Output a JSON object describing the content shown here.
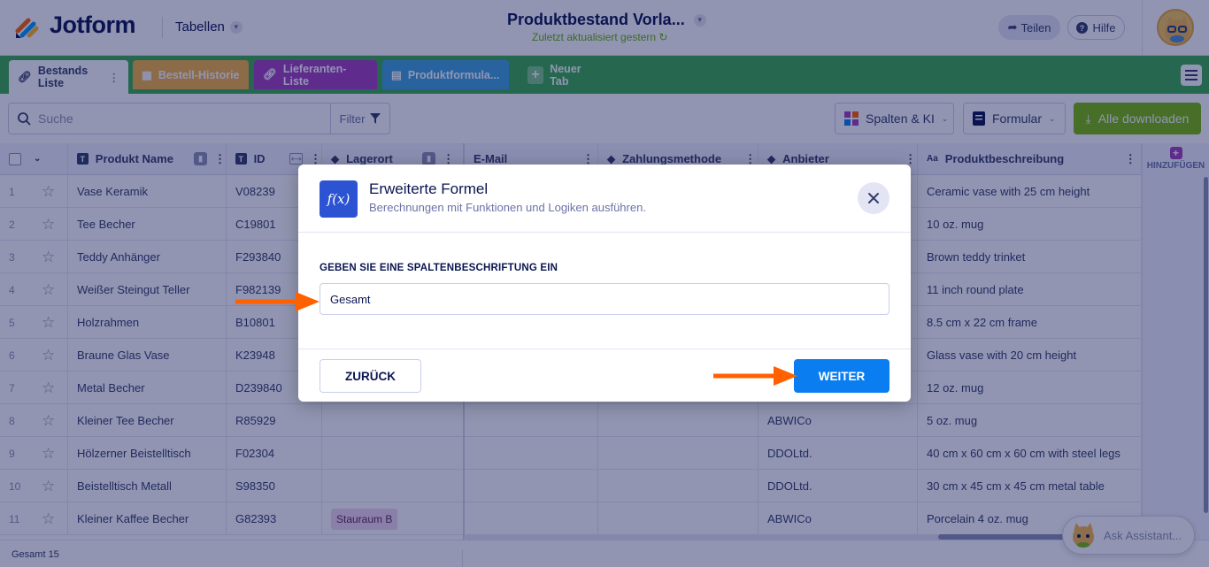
{
  "header": {
    "logo_text": "Jotform",
    "tables_label": "Tabellen",
    "doc_title": "Produktbestand Vorla...",
    "doc_subtitle": "Zuletzt aktualisiert gestern",
    "share_label": "Teilen",
    "help_label": "Hilfe"
  },
  "tabs": [
    {
      "label": "Bestands Liste",
      "color": "#ffffff"
    },
    {
      "label": "Bestell-Historie",
      "color": "#f5b340"
    },
    {
      "label": "Lieferanten-Liste",
      "color": "#a53fbd"
    },
    {
      "label": "Produktformula...",
      "color": "#41a5e0"
    },
    {
      "label": "Neuer Tab"
    }
  ],
  "toolbar": {
    "search_placeholder": "Suche",
    "filter_label": "Filter",
    "columns_label": "Spalten & KI",
    "form_label": "Formular",
    "download_label": "Alle downloaden"
  },
  "table": {
    "columns": [
      "Produkt Name",
      "ID",
      "Lagerort",
      "E-Mail",
      "Zahlungsmethode",
      "Anbieter",
      "Produktbeschreibung"
    ],
    "add_column_label": "HINZUFÜGEN",
    "rows": [
      {
        "n": "1",
        "name": "Vase Keramik",
        "id": "V08239",
        "lager": "",
        "anbieter": "",
        "desc": "Ceramic vase with 25 cm height"
      },
      {
        "n": "2",
        "name": "Tee Becher",
        "id": "C19801",
        "lager": "",
        "anbieter": "",
        "desc": "10 oz. mug"
      },
      {
        "n": "3",
        "name": "Teddy Anhänger",
        "id": "F293840",
        "lager": "",
        "anbieter": "",
        "desc": "Brown teddy trinket"
      },
      {
        "n": "4",
        "name": "Weißer Steingut Teller",
        "id": "F982139",
        "lager": "",
        "anbieter": "",
        "desc": "11 inch round plate"
      },
      {
        "n": "5",
        "name": "Holzrahmen",
        "id": "B10801",
        "lager": "",
        "anbieter": "",
        "desc": "8.5 cm x 22 cm frame"
      },
      {
        "n": "6",
        "name": "Braune Glas Vase",
        "id": "K23948",
        "lager": "",
        "anbieter": "",
        "desc": "Glass vase with 20 cm height"
      },
      {
        "n": "7",
        "name": "Metal Becher",
        "id": "D239840",
        "lager": "",
        "anbieter": "",
        "desc": "12 oz. mug"
      },
      {
        "n": "8",
        "name": "Kleiner Tee Becher",
        "id": "R85929",
        "lager": "",
        "anbieter": "ABWICo",
        "desc": "5 oz. mug"
      },
      {
        "n": "9",
        "name": "Hölzerner Beistelltisch",
        "id": "F02304",
        "lager": "",
        "anbieter": "DDOLtd.",
        "desc": "40 cm x 60 cm x 60 cm with steel legs"
      },
      {
        "n": "10",
        "name": "Beistelltisch Metall",
        "id": "S98350",
        "lager": "",
        "anbieter": "DDOLtd.",
        "desc": "30 cm x 45 cm x 45 cm metal table"
      },
      {
        "n": "11",
        "name": "Kleiner Kaffee Becher",
        "id": "G82393",
        "lager": "Stauraum B",
        "anbieter": "ABWICo",
        "desc": "Porcelain 4 oz. mug"
      }
    ]
  },
  "footer": {
    "total_label": "Gesamt 15"
  },
  "assistant_label": "Ask Assistant...",
  "modal": {
    "title": "Erweiterte Formel",
    "subtitle": "Berechnungen mit Funktionen und Logiken ausführen.",
    "icon_text": "f(x)",
    "field_label": "GEBEN SIE EINE SPALTENBESCHRIFTUNG EIN",
    "field_value": "Gesamt",
    "back_label": "ZURÜCK",
    "next_label": "WEITER"
  },
  "colors": {
    "brand_green": "#3dad4e",
    "primary_blue": "#0a7ef0",
    "arrow_orange": "#ff6100",
    "download_green": "#78bb07"
  }
}
